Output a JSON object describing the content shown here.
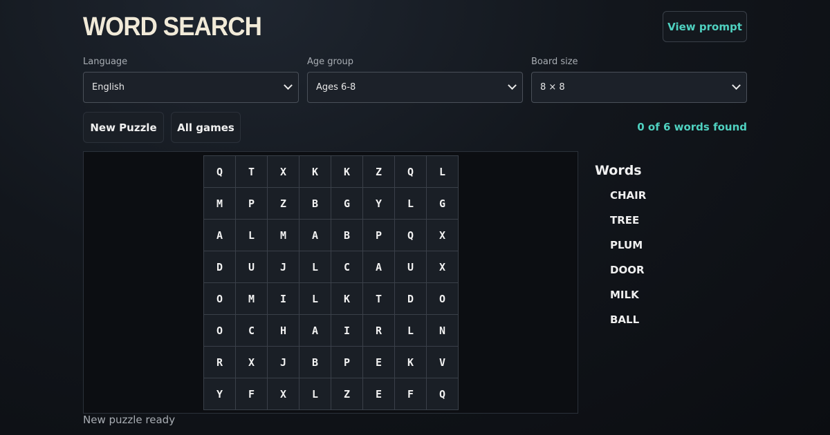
{
  "header": {
    "title": "WORD SEARCH",
    "view_prompt_label": "View prompt"
  },
  "controls": {
    "language": {
      "label": "Language",
      "value": "English"
    },
    "age_group": {
      "label": "Age group",
      "value": "Ages 6-8"
    },
    "board_size": {
      "label": "Board size",
      "value": "8 × 8"
    }
  },
  "actions": {
    "new_puzzle_label": "New Puzzle",
    "all_games_label": "All games"
  },
  "progress": {
    "text": "0 of 6 words found",
    "found": 0,
    "total": 6
  },
  "grid": [
    [
      "Q",
      "T",
      "X",
      "K",
      "K",
      "Z",
      "Q",
      "L"
    ],
    [
      "M",
      "P",
      "Z",
      "B",
      "G",
      "Y",
      "L",
      "G"
    ],
    [
      "A",
      "L",
      "M",
      "A",
      "B",
      "P",
      "Q",
      "X"
    ],
    [
      "D",
      "U",
      "J",
      "L",
      "C",
      "A",
      "U",
      "X"
    ],
    [
      "O",
      "M",
      "I",
      "L",
      "K",
      "T",
      "D",
      "O"
    ],
    [
      "O",
      "C",
      "H",
      "A",
      "I",
      "R",
      "L",
      "N"
    ],
    [
      "R",
      "X",
      "J",
      "B",
      "P",
      "E",
      "K",
      "V"
    ],
    [
      "Y",
      "F",
      "X",
      "L",
      "Z",
      "E",
      "F",
      "Q"
    ]
  ],
  "word_list": {
    "heading": "Words",
    "items": [
      "CHAIR",
      "TREE",
      "PLUM",
      "DOOR",
      "MILK",
      "BALL"
    ]
  },
  "status": "New puzzle ready",
  "colors": {
    "accent": "#4fd1c0",
    "background": "#0b0d11",
    "cell": "#1a1f26"
  },
  "icons": {
    "select_caret": "chevron-down-icon"
  }
}
